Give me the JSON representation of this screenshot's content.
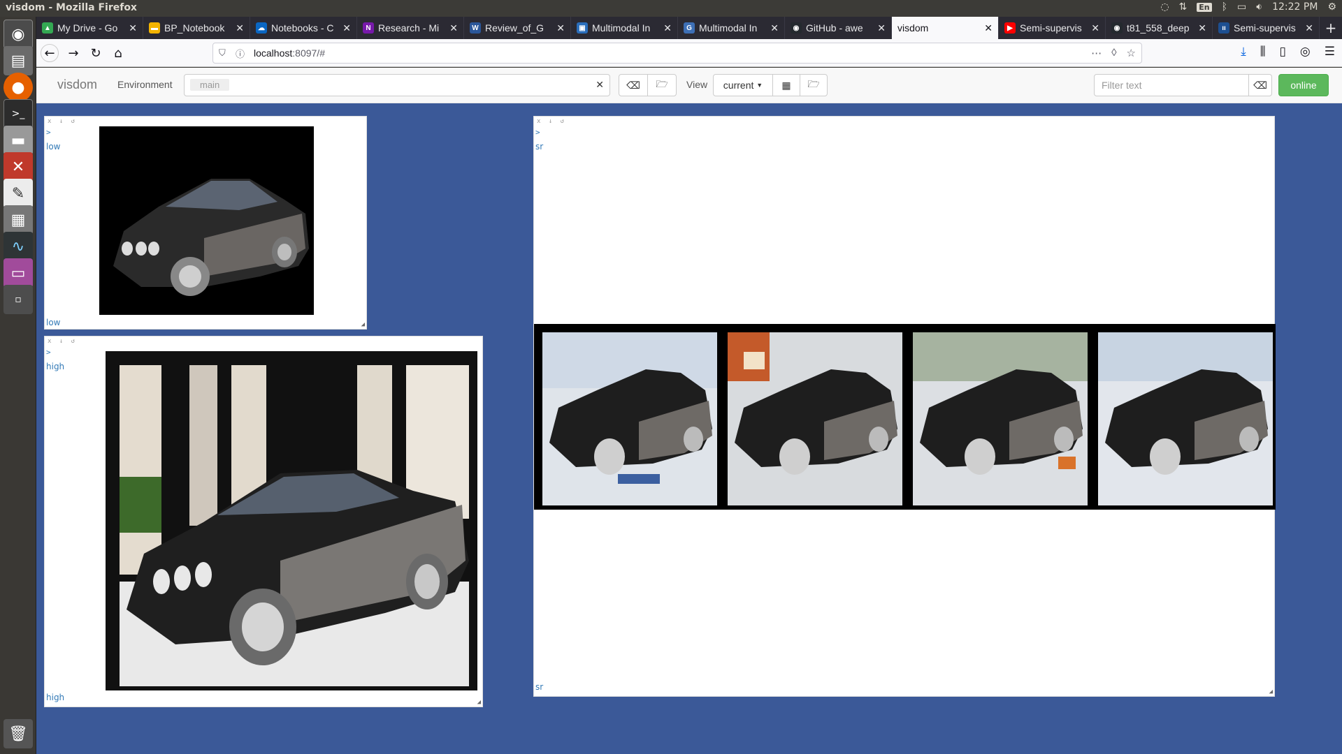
{
  "window": {
    "title": "visdom - Mozilla Firefox"
  },
  "system_tray": {
    "lang": "En",
    "time": "12:22 PM"
  },
  "launcher": {
    "icons": [
      "ubuntu-dash-icon",
      "file-manager-icon",
      "firefox-icon",
      "terminal-icon",
      "disk-drive-icon",
      "settings-icon",
      "text-editor-icon",
      "calculator-icon",
      "system-monitor-icon",
      "app-store-icon",
      "workspace-switcher-icon",
      "trash-icon"
    ]
  },
  "tabs": [
    {
      "label": "My Drive - Go",
      "color": "#34a853",
      "glyph": "▲",
      "active": false
    },
    {
      "label": "BP_Notebook",
      "color": "#f4b400",
      "glyph": "▬",
      "active": false
    },
    {
      "label": "Notebooks - C",
      "color": "#0a66c2",
      "glyph": "☁",
      "active": false
    },
    {
      "label": "Research - Mi",
      "color": "#7719aa",
      "glyph": "N",
      "active": false
    },
    {
      "label": "Review_of_G",
      "color": "#2b579a",
      "glyph": "W",
      "active": false
    },
    {
      "label": "Multimodal In",
      "color": "#2a6ebb",
      "glyph": "▣",
      "active": false
    },
    {
      "label": "Multimodal In",
      "color": "#3d6fb5",
      "glyph": "G",
      "active": false
    },
    {
      "label": "GitHub - awe",
      "color": "#24292e",
      "glyph": "◉",
      "active": false
    },
    {
      "label": "visdom",
      "color": "transparent",
      "glyph": "",
      "active": true
    },
    {
      "label": "Semi-supervis",
      "color": "#ff0000",
      "glyph": "▶",
      "active": false
    },
    {
      "label": "t81_558_deep",
      "color": "#24292e",
      "glyph": "◉",
      "active": false
    },
    {
      "label": "Semi-supervis",
      "color": "#1d4f91",
      "glyph": "ıı",
      "active": false
    }
  ],
  "url": {
    "host": "localhost",
    "rest": ":8097/#"
  },
  "visdom": {
    "brand": "visdom",
    "env_label": "Environment",
    "env_value": "main",
    "clear": "✕",
    "view_label": "View",
    "view_value": "current",
    "filter_placeholder": "Filter text",
    "status": "online"
  },
  "panes": {
    "low": {
      "title": "low",
      "caption": "low",
      "prompt": ">"
    },
    "high": {
      "title": "high",
      "caption": "high",
      "prompt": ">"
    },
    "sr": {
      "title": "sr",
      "caption": "sr",
      "prompt": ">",
      "grid_count": 4
    }
  },
  "colors": {
    "workspace_bg": "#3b5998",
    "online_green": "#5cb85c",
    "link_blue": "#337ab7"
  }
}
